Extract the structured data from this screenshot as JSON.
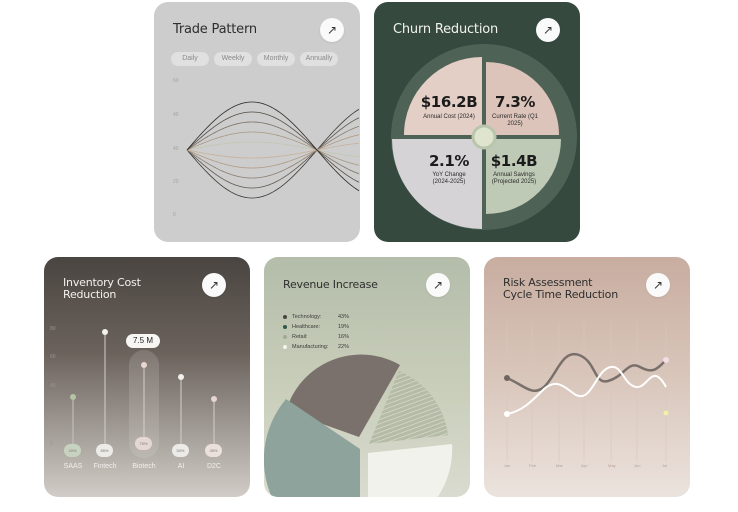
{
  "trade_pattern": {
    "title": "Trade Pattern",
    "tabs": [
      "Daily",
      "Weekly",
      "Monthly",
      "Annually"
    ],
    "y_ticks": [
      "60",
      "40",
      "40",
      "20",
      "0"
    ]
  },
  "churn_reduction": {
    "title": "Churn Reduction",
    "stats": [
      {
        "value": "$16.2B",
        "label": "Annual Cost (2024)"
      },
      {
        "value": "7.3%",
        "label": "Current Rate (Q1 2025)"
      },
      {
        "value": "2.1%",
        "label": "YoY Change (2024-2025)"
      },
      {
        "value": "$1.4B",
        "label": "Annual Savings (Projected 2025)"
      }
    ],
    "colors": {
      "background": "#35493f",
      "rose": "#e4cfc6",
      "grey": "#d5d3d6",
      "sage": "#bfcab6"
    }
  },
  "inventory_cost": {
    "title": "Inventory Cost Reduction",
    "tooltip": "7.5 M",
    "y_ticks": [
      "80",
      "60",
      "40",
      "20",
      "0"
    ],
    "categories": [
      "SAAS",
      "Fintech",
      "Biotech",
      "AI",
      "D2C"
    ],
    "badges": [
      "20%",
      "85%",
      "70%",
      "50%",
      "35%"
    ],
    "values": [
      25,
      85,
      70,
      50,
      35
    ]
  },
  "revenue_increase": {
    "title": "Revenue Increase",
    "legend": [
      {
        "label": "Technology:",
        "value": "43%",
        "color": "#6d635e"
      },
      {
        "label": "Healthcare:",
        "value": "19%",
        "color": "#6e8b80"
      },
      {
        "label": "Retail:",
        "value": "16%",
        "color": "#a9b09a"
      },
      {
        "label": "Manufacturing:",
        "value": "22%",
        "color": "#f2f2ec"
      }
    ],
    "chart_data": {
      "type": "pie",
      "categories": [
        "Technology",
        "Healthcare",
        "Retail",
        "Manufacturing"
      ],
      "values": [
        43,
        19,
        16,
        22
      ]
    }
  },
  "risk_assessment": {
    "title": "Risk Assessment Cycle Time Reduction",
    "x_ticks": [
      "Jan",
      "Feb",
      "Mar",
      "Apr",
      "May",
      "Jun",
      "Jul",
      "Aug"
    ]
  }
}
